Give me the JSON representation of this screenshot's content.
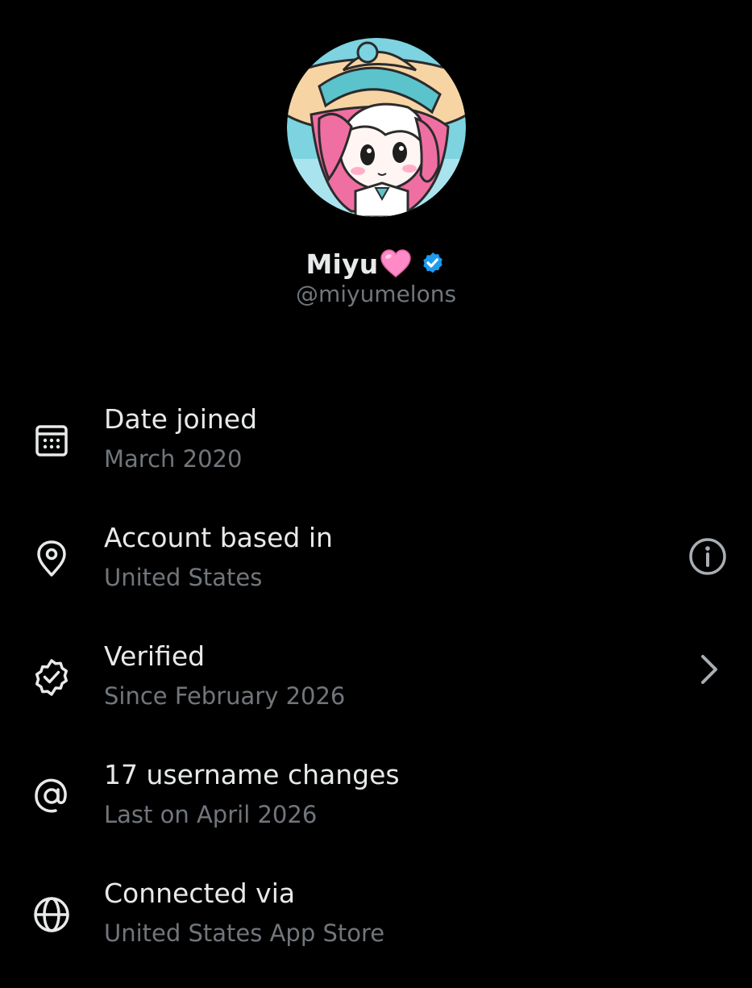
{
  "profile": {
    "display_name": "Miyu",
    "handle": "@miyumelons",
    "avatar": "anime-girl-avatar",
    "name_emoji": "pink-heart-icon",
    "badge": "verified-badge-icon"
  },
  "colors": {
    "background": "#000000",
    "primary_text": "#e7e9ea",
    "secondary_text": "#71767b",
    "verified_blue": "#1d9bf0",
    "heart_pink": "#ff8ac8"
  },
  "rows": [
    {
      "icon": "calendar-icon",
      "title": "Date joined",
      "subtitle": "March 2020"
    },
    {
      "icon": "location-pin-icon",
      "title": "Account based in",
      "subtitle": "United States",
      "trailing_icon": "info-icon"
    },
    {
      "icon": "verified-outline-icon",
      "title": "Verified",
      "subtitle": "Since February 2026",
      "trailing_icon": "chevron-right-icon"
    },
    {
      "icon": "at-sign-icon",
      "title": "17 username changes",
      "subtitle": "Last on April 2026"
    },
    {
      "icon": "globe-icon",
      "title": "Connected via",
      "subtitle": "United States App Store"
    }
  ]
}
